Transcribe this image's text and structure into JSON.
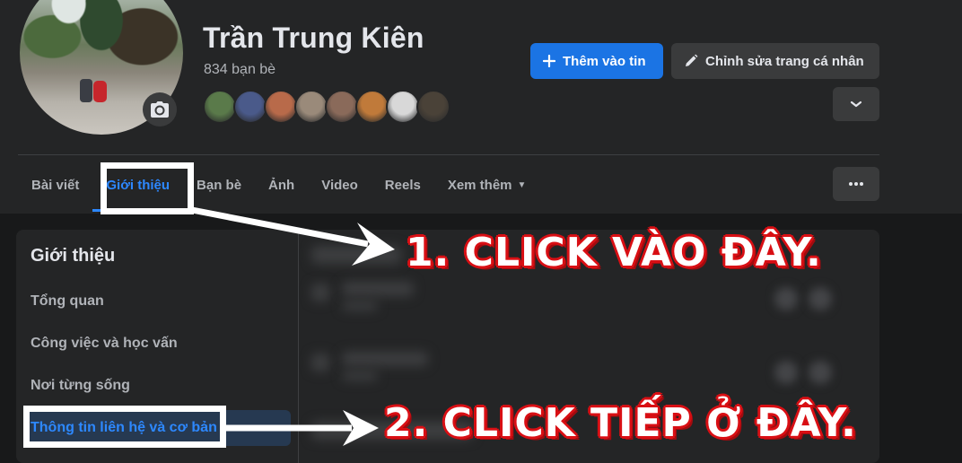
{
  "profile": {
    "name": "Trần Trung Kiên",
    "friend_count": "834 bạn bè",
    "friend_avatar_colors": [
      "#5a7a4a",
      "#4a5a8a",
      "#b86a4a",
      "#9a8a7a",
      "#8a6a5a",
      "#c07a3a",
      "#d8d8d8",
      "#4a4238"
    ]
  },
  "actions": {
    "add_story": "Thêm vào tin",
    "edit_profile": "Chỉnh sửa trang cá nhân"
  },
  "tabs": [
    {
      "label": "Bài viết"
    },
    {
      "label": "Giới thiệu"
    },
    {
      "label": "Bạn bè"
    },
    {
      "label": "Ảnh"
    },
    {
      "label": "Video"
    },
    {
      "label": "Reels"
    },
    {
      "label": "Xem thêm"
    }
  ],
  "about": {
    "title": "Giới thiệu",
    "items": [
      {
        "label": "Tổng quan"
      },
      {
        "label": "Công việc và học vấn"
      },
      {
        "label": "Nơi từng sống"
      },
      {
        "label": "Thông tin liên hệ và cơ bản"
      }
    ]
  },
  "annotations": {
    "step1": "1. CLICK VÀO ĐÂY.",
    "step2": "2. CLICK TIẾP Ở ĐÂY."
  },
  "colors": {
    "accent": "#2d88ff",
    "primary_button": "#1b74e4",
    "annotation_outline": "#d90f14"
  }
}
